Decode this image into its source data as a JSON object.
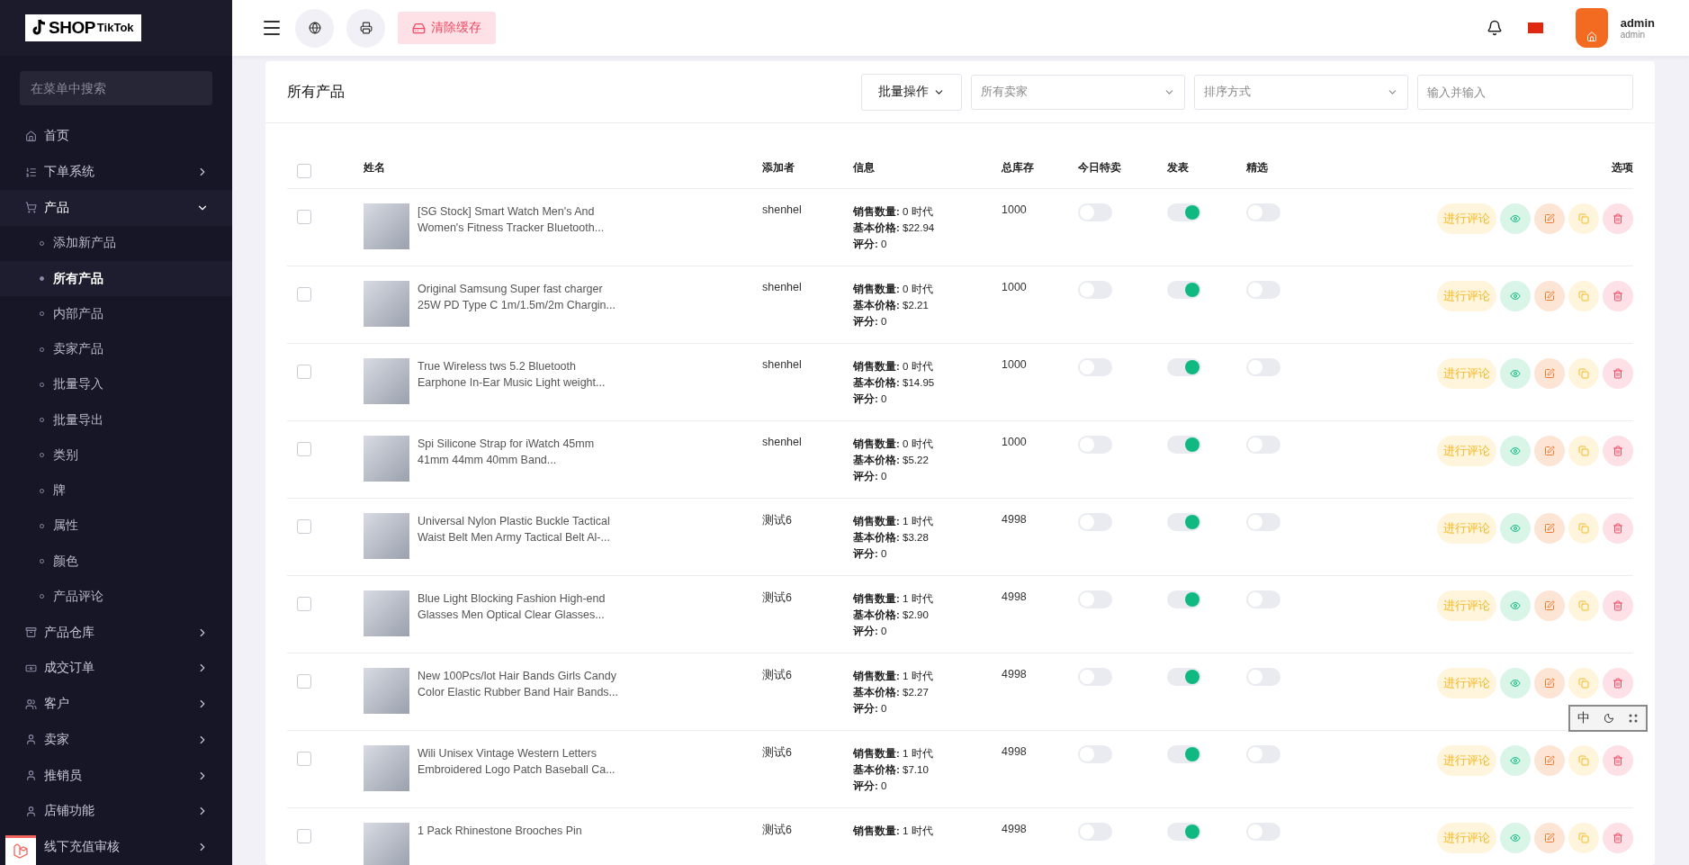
{
  "sidebar": {
    "logo": {
      "mark": "SHOP",
      "sub": "TikTok"
    },
    "search": {
      "placeholder": "在菜单中搜索"
    },
    "items": [
      {
        "label": "首页",
        "expanded": false,
        "has_children": false
      },
      {
        "label": "下单系统",
        "expanded": false,
        "has_children": true
      },
      {
        "label": "产品",
        "expanded": true,
        "has_children": true,
        "children": [
          {
            "label": "添加新产品",
            "selected": false
          },
          {
            "label": "所有产品",
            "selected": true
          },
          {
            "label": "内部产品",
            "selected": false
          },
          {
            "label": "卖家产品",
            "selected": false
          },
          {
            "label": "批量导入",
            "selected": false
          },
          {
            "label": "批量导出",
            "selected": false
          },
          {
            "label": "类别",
            "selected": false
          },
          {
            "label": "牌",
            "selected": false
          },
          {
            "label": "属性",
            "selected": false
          },
          {
            "label": "颜色",
            "selected": false
          },
          {
            "label": "产品评论",
            "selected": false
          }
        ]
      },
      {
        "label": "产品仓库",
        "expanded": false,
        "has_children": true
      },
      {
        "label": "成交订单",
        "expanded": false,
        "has_children": true
      },
      {
        "label": "客户",
        "expanded": false,
        "has_children": true
      },
      {
        "label": "卖家",
        "expanded": false,
        "has_children": true
      },
      {
        "label": "推销员",
        "expanded": false,
        "has_children": true
      },
      {
        "label": "店铺功能",
        "expanded": false,
        "has_children": true
      },
      {
        "label": "线下充值审核",
        "expanded": false,
        "has_children": true
      }
    ]
  },
  "header": {
    "clear_cache": "清除缓存",
    "user": {
      "name": "admin",
      "role": "admin"
    }
  },
  "card": {
    "title": "所有产品",
    "bulk": "批量操作",
    "seller_select": {
      "placeholder": "所有卖家"
    },
    "sort_select": {
      "placeholder": "排序方式"
    },
    "search": {
      "placeholder": "输入并输入"
    }
  },
  "table": {
    "select_all": false,
    "columns": [
      "姓名",
      "添加者",
      "信息",
      "总库存",
      "今日特卖",
      "发表",
      "精选",
      "选项"
    ],
    "rows": [
      {
        "checked": false,
        "name": "[SG Stock] Smart Watch Men's And Women's Fitness Tracker Bluetooth...",
        "added_by": "shenhel",
        "sales": "**销售数量:** 0 时代",
        "price": "**基本价格:** $22.94",
        "rating": "**评分:** 0",
        "stock": "1000",
        "today_deal": false,
        "published": true,
        "featured": false,
        "review": "进行评论"
      },
      {
        "checked": false,
        "name": "Original Samsung Super fast charger 25W PD Type C 1m/1.5m/2m Chargin...",
        "added_by": "shenhel",
        "sales": "**销售数量:** 0 时代",
        "price": "**基本价格:** $2.21",
        "rating": "**评分:** 0",
        "stock": "1000",
        "today_deal": false,
        "published": true,
        "featured": false,
        "review": "进行评论"
      },
      {
        "checked": false,
        "name": "True Wireless tws 5.2 Bluetooth Earphone In-Ear Music Light weight...",
        "added_by": "shenhel",
        "sales": "**销售数量:** 0 时代",
        "price": "**基本价格:** $14.95",
        "rating": "**评分:** 0",
        "stock": "1000",
        "today_deal": false,
        "published": true,
        "featured": false,
        "review": "进行评论"
      },
      {
        "checked": false,
        "name": "Spi Silicone Strap for iWatch 45mm 41mm 44mm 40mm Band...",
        "added_by": "shenhel",
        "sales": "**销售数量:** 0 时代",
        "price": "**基本价格:** $5.22",
        "rating": "**评分:** 0",
        "stock": "1000",
        "today_deal": false,
        "published": true,
        "featured": false,
        "review": "进行评论"
      },
      {
        "checked": false,
        "name": "Universal Nylon Plastic Buckle Tactical Waist Belt Men Army Tactical Belt Al-...",
        "added_by": "测试6",
        "sales": "**销售数量:** 1 时代",
        "price": "**基本价格:** $3.28",
        "rating": "**评分:** 0",
        "stock": "4998",
        "today_deal": false,
        "published": true,
        "featured": false,
        "review": "进行评论"
      },
      {
        "checked": false,
        "name": "Blue Light Blocking Fashion High-end Glasses Men Optical Clear Glasses...",
        "added_by": "测试6",
        "sales": "**销售数量:** 1 时代",
        "price": "**基本价格:** $2.90",
        "rating": "**评分:** 0",
        "stock": "4998",
        "today_deal": false,
        "published": true,
        "featured": false,
        "review": "进行评论"
      },
      {
        "checked": false,
        "name": "New 100Pcs/lot Hair Bands Girls Candy Color Elastic Rubber Band Hair Bands...",
        "added_by": "测试6",
        "sales": "**销售数量:** 1 时代",
        "price": "**基本价格:** $2.27",
        "rating": "**评分:** 0",
        "stock": "4998",
        "today_deal": false,
        "published": true,
        "featured": false,
        "review": "进行评论"
      },
      {
        "checked": false,
        "name": "Wili Unisex Vintage Western Letters Embroidered Logo Patch Baseball Ca...",
        "added_by": "测试6",
        "sales": "**销售数量:** 1 时代",
        "price": "**基本价格:** $7.10",
        "rating": "**评分:** 0",
        "stock": "4998",
        "today_deal": false,
        "published": true,
        "featured": false,
        "review": "进行评论"
      },
      {
        "checked": false,
        "name": "1 Pack Rhinestone Brooches Pin",
        "added_by": "测试6",
        "sales": "**销售数量:** 1 时代",
        "stock": "4998",
        "today_deal": false,
        "published": true,
        "featured": false,
        "review": "进行评论"
      }
    ]
  },
  "ime_bar": {
    "label": "中"
  }
}
